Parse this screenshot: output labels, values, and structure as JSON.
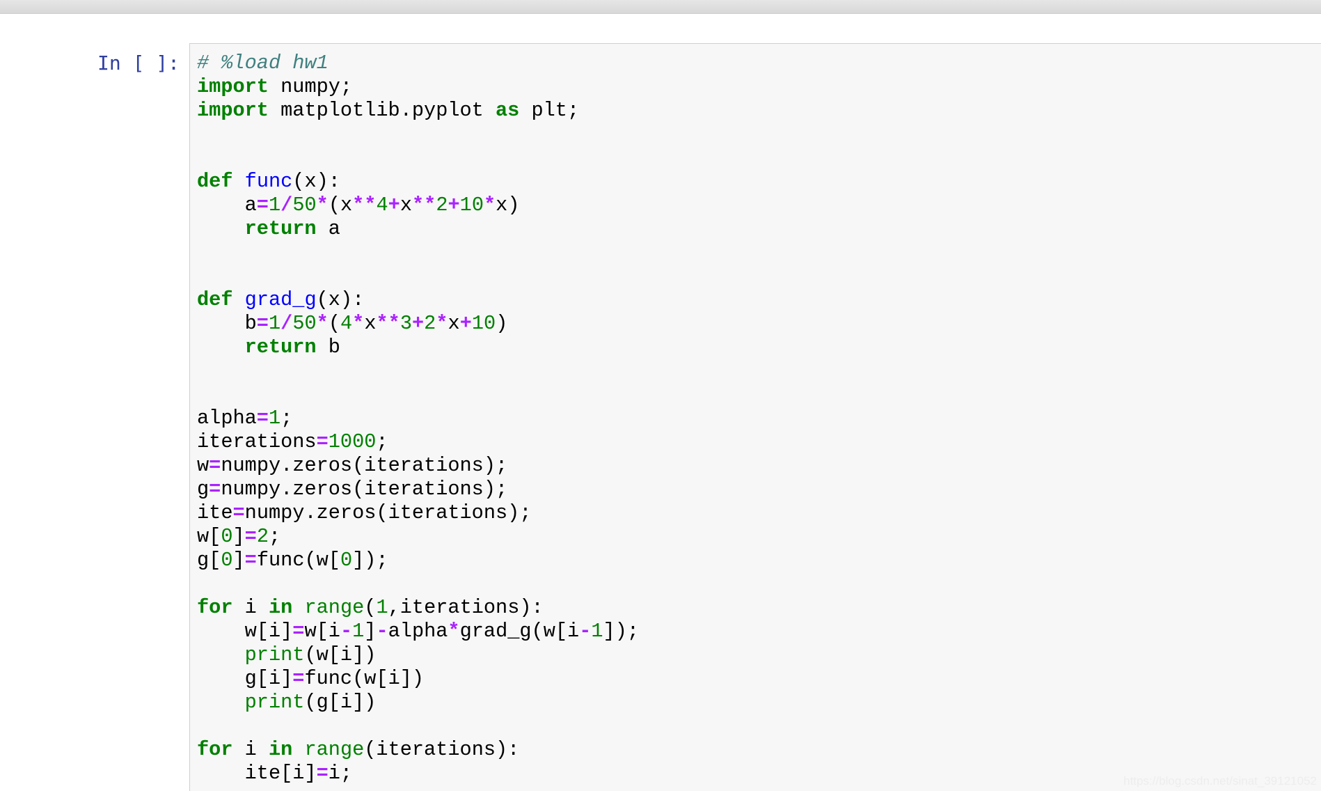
{
  "prompt": {
    "label": "In [ ]:"
  },
  "code_lines": [
    [
      [
        "comment",
        "# %load hw1"
      ]
    ],
    [
      [
        "kw",
        "import"
      ],
      [
        "plain",
        " numpy;"
      ]
    ],
    [
      [
        "kw",
        "import"
      ],
      [
        "plain",
        " matplotlib.pyplot "
      ],
      [
        "kw",
        "as"
      ],
      [
        "plain",
        " plt;"
      ]
    ],
    [],
    [],
    [
      [
        "kw",
        "def"
      ],
      [
        "plain",
        " "
      ],
      [
        "fn",
        "func"
      ],
      [
        "plain",
        "(x):"
      ]
    ],
    [
      [
        "plain",
        "    a"
      ],
      [
        "op",
        "="
      ],
      [
        "num",
        "1"
      ],
      [
        "op",
        "/"
      ],
      [
        "num",
        "50"
      ],
      [
        "op",
        "*"
      ],
      [
        "plain",
        "(x"
      ],
      [
        "op",
        "**"
      ],
      [
        "num",
        "4"
      ],
      [
        "op",
        "+"
      ],
      [
        "plain",
        "x"
      ],
      [
        "op",
        "**"
      ],
      [
        "num",
        "2"
      ],
      [
        "op",
        "+"
      ],
      [
        "num",
        "10"
      ],
      [
        "op",
        "*"
      ],
      [
        "plain",
        "x)"
      ]
    ],
    [
      [
        "plain",
        "    "
      ],
      [
        "kw",
        "return"
      ],
      [
        "plain",
        " a"
      ]
    ],
    [],
    [],
    [
      [
        "kw",
        "def"
      ],
      [
        "plain",
        " "
      ],
      [
        "fn",
        "grad_g"
      ],
      [
        "plain",
        "(x):"
      ]
    ],
    [
      [
        "plain",
        "    b"
      ],
      [
        "op",
        "="
      ],
      [
        "num",
        "1"
      ],
      [
        "op",
        "/"
      ],
      [
        "num",
        "50"
      ],
      [
        "op",
        "*"
      ],
      [
        "plain",
        "("
      ],
      [
        "num",
        "4"
      ],
      [
        "op",
        "*"
      ],
      [
        "plain",
        "x"
      ],
      [
        "op",
        "**"
      ],
      [
        "num",
        "3"
      ],
      [
        "op",
        "+"
      ],
      [
        "num",
        "2"
      ],
      [
        "op",
        "*"
      ],
      [
        "plain",
        "x"
      ],
      [
        "op",
        "+"
      ],
      [
        "num",
        "10"
      ],
      [
        "plain",
        ")"
      ]
    ],
    [
      [
        "plain",
        "    "
      ],
      [
        "kw",
        "return"
      ],
      [
        "plain",
        " b"
      ]
    ],
    [],
    [],
    [
      [
        "plain",
        "alpha"
      ],
      [
        "op",
        "="
      ],
      [
        "num",
        "1"
      ],
      [
        "plain",
        ";"
      ]
    ],
    [
      [
        "plain",
        "iterations"
      ],
      [
        "op",
        "="
      ],
      [
        "num",
        "1000"
      ],
      [
        "plain",
        ";"
      ]
    ],
    [
      [
        "plain",
        "w"
      ],
      [
        "op",
        "="
      ],
      [
        "plain",
        "numpy.zeros(iterations);"
      ]
    ],
    [
      [
        "plain",
        "g"
      ],
      [
        "op",
        "="
      ],
      [
        "plain",
        "numpy.zeros(iterations);"
      ]
    ],
    [
      [
        "plain",
        "ite"
      ],
      [
        "op",
        "="
      ],
      [
        "plain",
        "numpy.zeros(iterations);"
      ]
    ],
    [
      [
        "plain",
        "w["
      ],
      [
        "num",
        "0"
      ],
      [
        "plain",
        "]"
      ],
      [
        "op",
        "="
      ],
      [
        "num",
        "2"
      ],
      [
        "plain",
        ";"
      ]
    ],
    [
      [
        "plain",
        "g["
      ],
      [
        "num",
        "0"
      ],
      [
        "plain",
        "]"
      ],
      [
        "op",
        "="
      ],
      [
        "plain",
        "func(w["
      ],
      [
        "num",
        "0"
      ],
      [
        "plain",
        "]);"
      ]
    ],
    [],
    [
      [
        "kw",
        "for"
      ],
      [
        "plain",
        " i "
      ],
      [
        "kw",
        "in"
      ],
      [
        "plain",
        " "
      ],
      [
        "builtin",
        "range"
      ],
      [
        "plain",
        "("
      ],
      [
        "num",
        "1"
      ],
      [
        "plain",
        ",iterations):"
      ]
    ],
    [
      [
        "plain",
        "    w[i]"
      ],
      [
        "op",
        "="
      ],
      [
        "plain",
        "w[i"
      ],
      [
        "op",
        "-"
      ],
      [
        "num",
        "1"
      ],
      [
        "plain",
        "]"
      ],
      [
        "op",
        "-"
      ],
      [
        "plain",
        "alpha"
      ],
      [
        "op",
        "*"
      ],
      [
        "plain",
        "grad_g(w[i"
      ],
      [
        "op",
        "-"
      ],
      [
        "num",
        "1"
      ],
      [
        "plain",
        "]);"
      ]
    ],
    [
      [
        "plain",
        "    "
      ],
      [
        "builtin",
        "print"
      ],
      [
        "plain",
        "(w[i])"
      ]
    ],
    [
      [
        "plain",
        "    g[i]"
      ],
      [
        "op",
        "="
      ],
      [
        "plain",
        "func(w[i])"
      ]
    ],
    [
      [
        "plain",
        "    "
      ],
      [
        "builtin",
        "print"
      ],
      [
        "plain",
        "(g[i])"
      ]
    ],
    [],
    [
      [
        "kw",
        "for"
      ],
      [
        "plain",
        " i "
      ],
      [
        "kw",
        "in"
      ],
      [
        "plain",
        " "
      ],
      [
        "builtin",
        "range"
      ],
      [
        "plain",
        "(iterations):"
      ]
    ],
    [
      [
        "plain",
        "    ite[i]"
      ],
      [
        "op",
        "="
      ],
      [
        "plain",
        "i;"
      ]
    ]
  ],
  "watermark": "https://blog.csdn.net/sinat_39121052",
  "colors": {
    "prompt": "#303f9f",
    "cell_bg": "#f7f7f7",
    "cell_border": "#cfcfcf",
    "keyword": "#008000",
    "function_name": "#0000ff",
    "operator": "#aa22ff",
    "number": "#008000",
    "comment": "#408080"
  }
}
